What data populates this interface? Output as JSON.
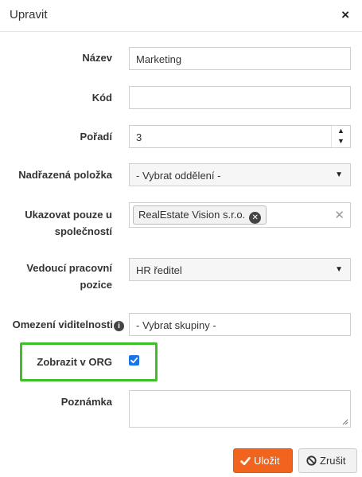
{
  "dialog": {
    "title": "Upravit",
    "close_glyph": "×"
  },
  "form": {
    "name": {
      "label": "Název",
      "value": "Marketing"
    },
    "code": {
      "label": "Kód",
      "value": ""
    },
    "order": {
      "label": "Pořadí",
      "value": "3",
      "up_glyph": "▲",
      "down_glyph": "▼"
    },
    "parent": {
      "label": "Nadřazená položka",
      "value": "- Vybrat oddělení -",
      "arrow": "▼"
    },
    "companies": {
      "label_line1": "Ukazovat pouze u",
      "label_line2": "společností",
      "chips": [
        "RealEstate Vision s.r.o."
      ],
      "chip_remove_glyph": "✕",
      "clear_glyph": "✕"
    },
    "position": {
      "label_line1": "Vedoucí pracovní",
      "label_line2": "pozice",
      "value": "HR ředitel",
      "arrow": "▼"
    },
    "visibility": {
      "label": "Omezení viditelnosti",
      "info_glyph": "i",
      "value": "- Vybrat skupiny -"
    },
    "show_in_org": {
      "label": "Zobrazit v ORG",
      "checked": true
    },
    "note": {
      "label": "Poznámka",
      "value": ""
    }
  },
  "buttons": {
    "save": {
      "label": "Uložit",
      "icon": "check-icon",
      "color": "#f0641e"
    },
    "cancel": {
      "label": "Zrušit",
      "icon": "ban-icon"
    }
  },
  "highlight_color": "#3fbf28"
}
